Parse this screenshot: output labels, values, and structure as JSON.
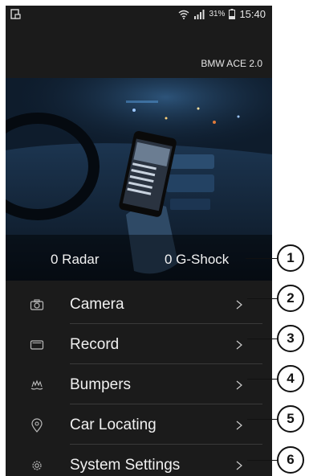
{
  "status_bar": {
    "battery_percent": "31%",
    "time": "15:40",
    "icons": [
      "screenshot-icon",
      "wifi-icon",
      "signal-icon",
      "battery-icon"
    ]
  },
  "app_bar": {
    "device_name": "BMW ACE 2.0"
  },
  "hero": {
    "radar_count": "0 Radar",
    "gshock_count": "0 G-Shock"
  },
  "menu": {
    "items": [
      {
        "label": "Camera",
        "icon": "camera-icon"
      },
      {
        "label": "Record",
        "icon": "record-icon"
      },
      {
        "label": "Bumpers",
        "icon": "bumpers-icon"
      },
      {
        "label": "Car Locating",
        "icon": "location-pin-icon"
      },
      {
        "label": "System Settings",
        "icon": "gear-icon"
      }
    ]
  },
  "callouts": [
    "1",
    "2",
    "3",
    "4",
    "5",
    "6"
  ]
}
